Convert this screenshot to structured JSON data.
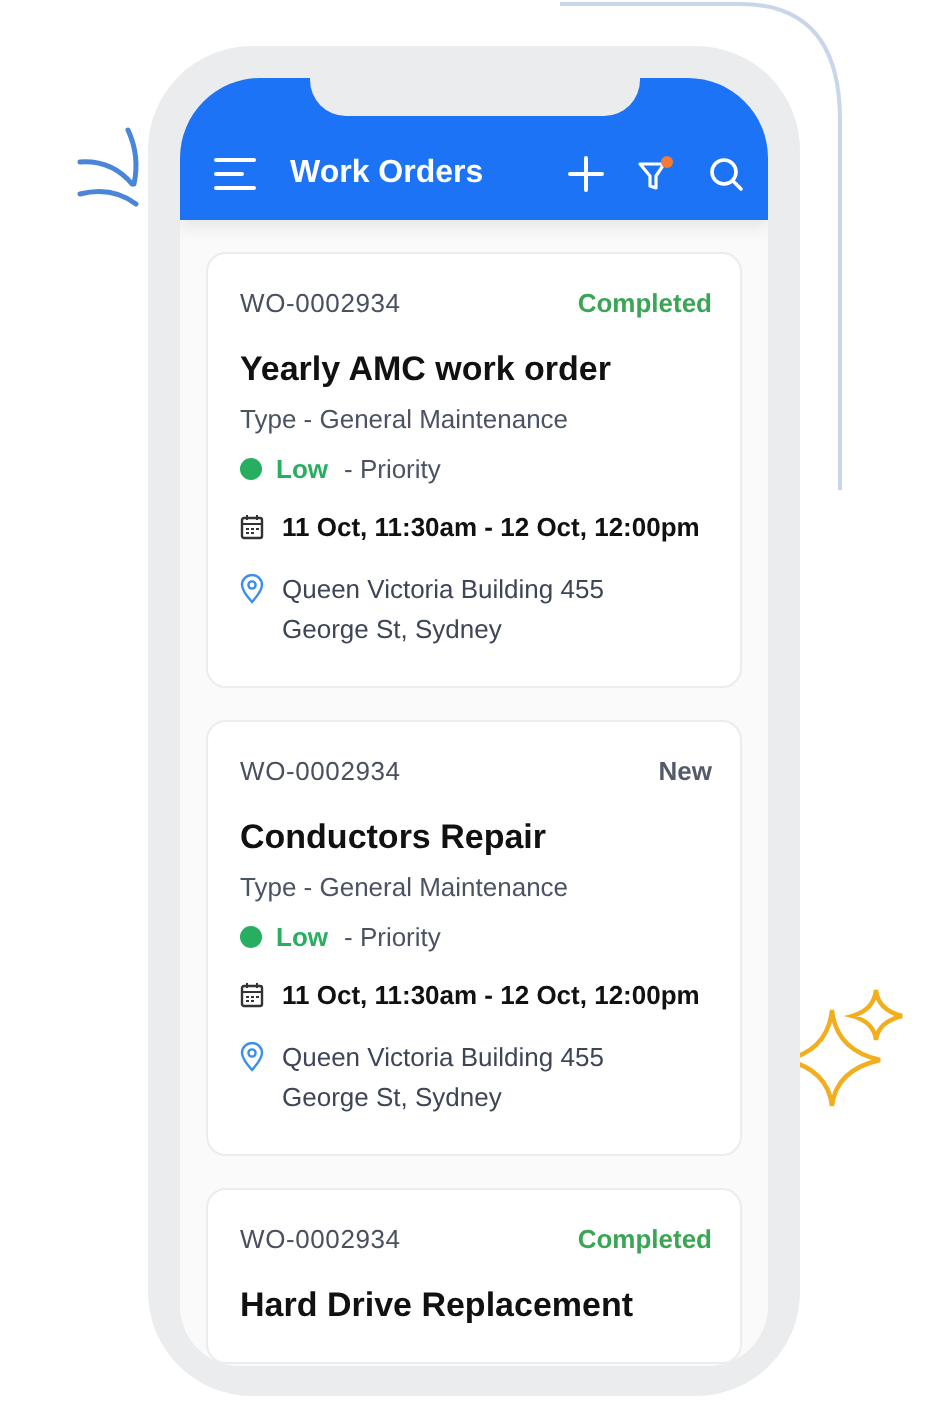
{
  "header": {
    "title": "Work Orders",
    "filter_active": true
  },
  "work_orders": [
    {
      "number": "WO-0002934",
      "status": {
        "text": "Completed",
        "color": "#3aa655"
      },
      "title": "Yearly AMC work order",
      "type": "Type - General Maintenance",
      "priority": {
        "text": "Low",
        "color": "#27ae60"
      },
      "priority_suffix": "-  Priority",
      "schedule": "11 Oct, 11:30am - 12 Oct, 12:00pm",
      "location": "Queen Victoria Building 455 George St, Sydney"
    },
    {
      "number": "WO-0002934",
      "status": {
        "text": "New",
        "color": "#555a6a"
      },
      "title": "Conductors Repair",
      "type": "Type - General Maintenance",
      "priority": {
        "text": "Low",
        "color": "#27ae60"
      },
      "priority_suffix": "-  Priority",
      "schedule": "11 Oct, 11:30am - 12 Oct, 12:00pm",
      "location": "Queen Victoria Building 455 George St, Sydney"
    },
    {
      "number": "WO-0002934",
      "status": {
        "text": "Completed",
        "color": "#3aa655"
      },
      "title": "Hard Drive Replacement"
    }
  ]
}
